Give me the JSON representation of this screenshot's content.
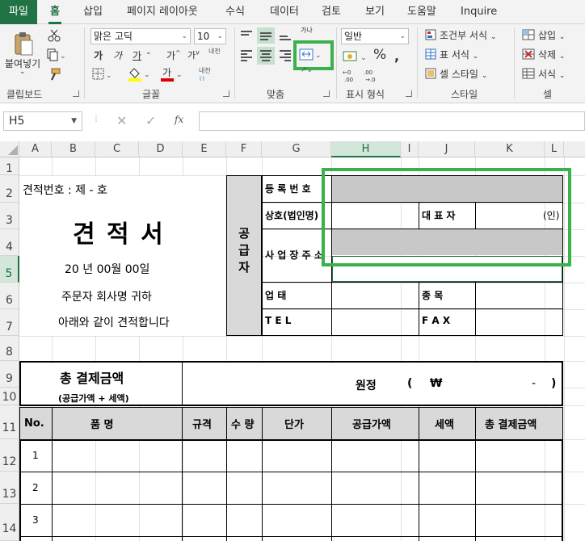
{
  "tabs": [
    "파일",
    "홈",
    "삽입",
    "페이지 레이아웃",
    "수식",
    "데이터",
    "검토",
    "보기",
    "도움말",
    "Inquire"
  ],
  "ribbon": {
    "clipboard": {
      "paste": "붙여넣기",
      "label": "클립보드"
    },
    "font": {
      "name": "맑은 고딕",
      "size": "10",
      "bold": "가",
      "italic": "가",
      "underline": "가",
      "grow": "가",
      "shrink": "가",
      "phonetic": "내천",
      "fontcolor": "가",
      "label": "글꼴"
    },
    "align": {
      "label": "맞춤",
      "wrap": "가나"
    },
    "number": {
      "format": "일반",
      "percent": "%",
      "label": "표시 형식"
    },
    "styles": {
      "conditional": "조건부 서식",
      "table": "표 서식",
      "cell": "셀 스타일",
      "label": "스타일"
    },
    "cells": {
      "insert": "삽입",
      "delete": "삭제",
      "format": "서식",
      "label": "셀"
    }
  },
  "formula_bar": {
    "name_box": "H5",
    "fx": "fx",
    "value": ""
  },
  "columns": [
    "A",
    "B",
    "C",
    "D",
    "E",
    "F",
    "G",
    "H",
    "I",
    "J",
    "K",
    "L"
  ],
  "rows": [
    "1",
    "2",
    "3",
    "4",
    "5",
    "6",
    "7",
    "8",
    "9",
    "10",
    "11",
    "12",
    "13",
    "14"
  ],
  "sheet": {
    "estimate_no": "견적번호 : 제 - 호",
    "title": "견 적 서",
    "date": "20  년     00월     00일",
    "orderer": "주문자 회사명       귀하",
    "intro": "아래와 같이 견적합니다",
    "supplier": "공 급 자",
    "reg_no": "등 록 번 호",
    "company": "상호(법인명)",
    "ceo": "대 표 자",
    "seal": "(인)",
    "address": "사 업 장 주 소",
    "biz_type": "업          태",
    "biz_item": "종          목",
    "tel": "T      E      L",
    "fax": "F      A      X",
    "total_title": "총 결제금액",
    "total_sub": "(공급가액 + 세액)",
    "won": "원정",
    "open_paren": "(",
    "currency": "₩",
    "dash": "-",
    "close_paren": ")",
    "headers": {
      "no": "No.",
      "item": "품         명",
      "spec": "규격",
      "qty": "수 량",
      "price": "단가",
      "supply": "공급가액",
      "tax": "세액",
      "total": "총 결제금액"
    },
    "item_rows": [
      "1",
      "2",
      "3"
    ]
  }
}
